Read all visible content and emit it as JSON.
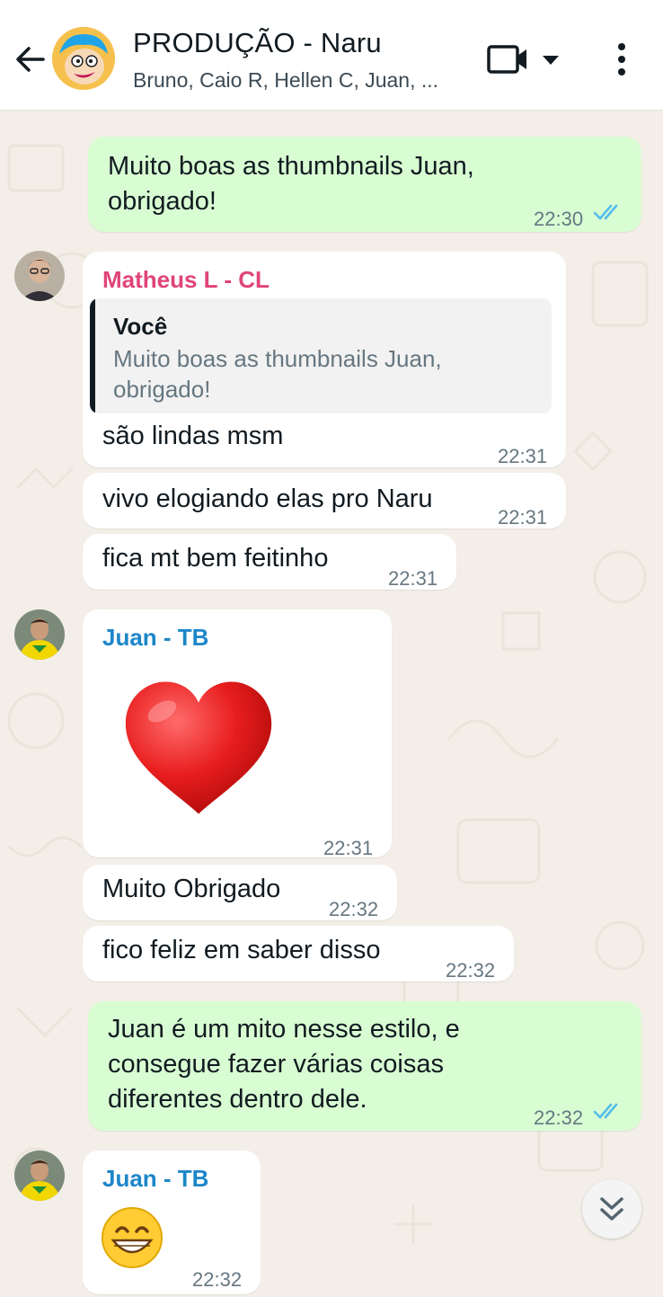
{
  "header": {
    "title": "PRODUÇÃO - Naru",
    "subtitle": "Bruno, Caio R, Hellen C, Juan, ...",
    "icons": [
      "back-arrow-icon",
      "group-avatar",
      "video-call-icon",
      "chevron-down-icon",
      "more-vert-icon"
    ]
  },
  "messages": [
    {
      "direction": "out",
      "text_lines": [
        "Muito boas as thumbnails Juan,",
        "obrigado!"
      ],
      "time": "22:30",
      "status": "read"
    },
    {
      "direction": "in",
      "sender": "Matheus L - CL",
      "quote": {
        "author": "Você",
        "text": "Muito boas as thumbnails Juan, obrigado!"
      },
      "text": "são lindas msm",
      "time": "22:31"
    },
    {
      "direction": "in",
      "text": "vivo elogiando elas pro Naru",
      "time": "22:31"
    },
    {
      "direction": "in",
      "text": "fica mt bem feitinho",
      "time": "22:31"
    },
    {
      "direction": "in",
      "sender": "Juan - TB",
      "sticker": "red-heart",
      "time": "22:31"
    },
    {
      "direction": "in",
      "text": "Muito Obrigado",
      "time": "22:32"
    },
    {
      "direction": "in",
      "text": "fico feliz em saber disso",
      "time": "22:32"
    },
    {
      "direction": "out",
      "text_lines": [
        "Juan é um mito nesse estilo, e",
        "consegue fazer várias coisas",
        "diferentes dentro dele."
      ],
      "time": "22:32",
      "status": "read"
    },
    {
      "direction": "in",
      "sender": "Juan - TB",
      "sticker": "grinning-face",
      "time": "22:32"
    }
  ],
  "colors": {
    "outgoing_bubble": "#d9fdd3",
    "incoming_bubble": "#ffffff",
    "read_ticks": "#53bdeb",
    "sender_matheus": "#e0447b",
    "sender_juan": "#1d86c9"
  }
}
